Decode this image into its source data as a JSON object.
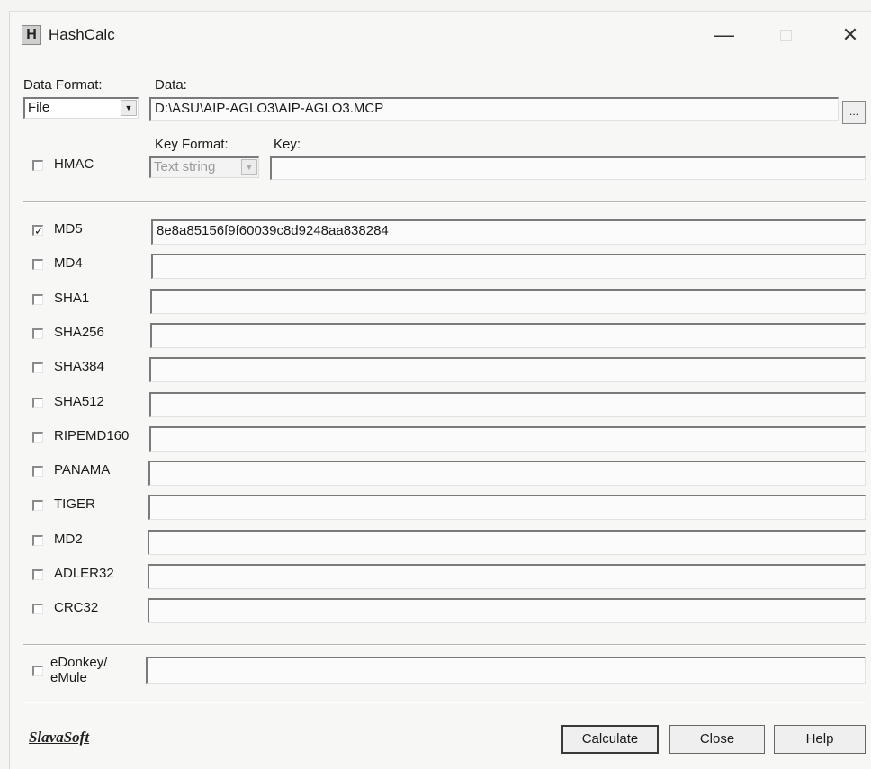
{
  "window": {
    "title": "HashCalc",
    "icon_letter": "H",
    "minimize_glyph": "—",
    "close_glyph": "✕"
  },
  "data_section": {
    "data_format_label": "Data Format:",
    "data_format_value": "File",
    "data_label": "Data:",
    "data_value": "D:\\ASU\\AIP-AGLO3\\AIP-AGLO3.MCP",
    "browse_label": "..."
  },
  "hmac": {
    "label": "HMAC",
    "checked": false,
    "key_format_label": "Key Format:",
    "key_format_value": "Text string",
    "key_label": "Key:",
    "key_value": ""
  },
  "algorithms": [
    {
      "label": "MD5",
      "checked": true,
      "value": "8e8a85156f9f60039c8d9248aa838284"
    },
    {
      "label": "MD4",
      "checked": false,
      "value": ""
    },
    {
      "label": "SHA1",
      "checked": false,
      "value": ""
    },
    {
      "label": "SHA256",
      "checked": false,
      "value": ""
    },
    {
      "label": "SHA384",
      "checked": false,
      "value": ""
    },
    {
      "label": "SHA512",
      "checked": false,
      "value": ""
    },
    {
      "label": "RIPEMD160",
      "checked": false,
      "value": ""
    },
    {
      "label": "PANAMA",
      "checked": false,
      "value": ""
    },
    {
      "label": "TIGER",
      "checked": false,
      "value": ""
    },
    {
      "label": "MD2",
      "checked": false,
      "value": ""
    },
    {
      "label": "ADLER32",
      "checked": false,
      "value": ""
    },
    {
      "label": "CRC32",
      "checked": false,
      "value": ""
    }
  ],
  "edonkey": {
    "label_line1": "eDonkey/",
    "label_line2": "eMule",
    "checked": false,
    "value": ""
  },
  "footer": {
    "logo": "SlavaSoft",
    "calculate_label": "Calculate",
    "close_label": "Close",
    "help_label": "Help"
  }
}
